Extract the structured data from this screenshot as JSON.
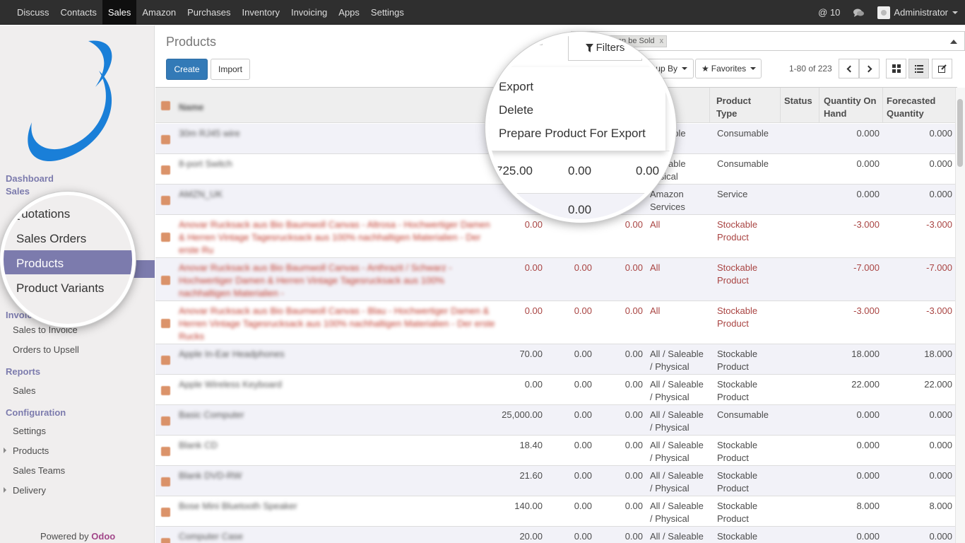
{
  "topbar": {
    "menu": [
      "Discuss",
      "Contacts",
      "Sales",
      "Amazon",
      "Purchases",
      "Inventory",
      "Invoicing",
      "Apps",
      "Settings"
    ],
    "active": "Sales",
    "mentions": "@ 10",
    "user": "Administrator"
  },
  "sidebar": {
    "sections": [
      {
        "title": "Dashboard"
      },
      {
        "title": "Sales",
        "items": [
          "Quotations",
          "Sales Orders",
          "Products",
          "Product Variants"
        ]
      },
      {
        "title": "Invoicing",
        "items": [
          "Sales to Invoice",
          "Orders to Upsell"
        ]
      },
      {
        "title": "Reports",
        "items": [
          "Sales"
        ]
      },
      {
        "title": "Configuration",
        "items": [
          "Settings",
          "Products",
          "Sales Teams",
          "Delivery"
        ]
      }
    ],
    "active_item": "Products",
    "powered_by": "Powered by",
    "powered_brand": "Odoo"
  },
  "main": {
    "title": "Products",
    "create": "Create",
    "import": "Import",
    "search_facet": "Can be Sold",
    "facet_remove": "x",
    "filters": "Filters",
    "group_by": "Group By",
    "favorites": "Favorites",
    "pager": "1-80 of 223"
  },
  "action_menu": {
    "items": [
      "Export",
      "Delete",
      "Prepare Product For Export"
    ]
  },
  "table": {
    "headers": [
      "Name",
      "Internal Category",
      "Product Type",
      "Status",
      "Quantity On Hand",
      "Forecasted Quantity"
    ],
    "header_fragments": {
      "internal_top": "rnal",
      "internal_bottom": "gory"
    },
    "lens_values": {
      "row1_col1": "725.00",
      "row1_col2": "0.00",
      "row1_col3": "0.00",
      "row2_col2": "0.00"
    },
    "rows": [
      {
        "name": "30m RJ45 wire",
        "price": "",
        "c2": "",
        "c3": "",
        "cat": "Saleable",
        "cat2": "ysical",
        "type": "Consumable",
        "type2": "",
        "onhand": "0.000",
        "forecast": "0.000",
        "red": false
      },
      {
        "name": "8-port Switch",
        "price": "",
        "c2": "",
        "c3": "",
        "cat": "Saleable",
        "cat2": "hysical",
        "type": "Consumable",
        "type2": "",
        "onhand": "0.000",
        "forecast": "0.000",
        "red": false
      },
      {
        "name": "AMZN_UK",
        "price": "",
        "c2": "",
        "c3": "",
        "cat": "Amazon",
        "cat2": "Services",
        "type": "Service",
        "type2": "",
        "onhand": "0.000",
        "forecast": "0.000",
        "red": false
      },
      {
        "name": "Anovar Rucksack aus Bio Baumwoll Canvas - Altrosa - Hochwertiger Damen & Herren Vintage Tagesrucksack aus 100% nachhaltigen Materialien - Der erste Ru",
        "price": "0.00",
        "c2": "",
        "c3": "0.00",
        "cat": "All",
        "cat2": "",
        "type": "Stockable",
        "type2": "Product",
        "onhand": "-3.000",
        "forecast": "-3.000",
        "red": true
      },
      {
        "name": "Anovar Rucksack aus Bio Baumwoll Canvas - Anthrazit / Schwarz - Hochwertiger Damen & Herren Vintage Tagesrucksack aus 100% nachhaltigen Materialien -",
        "price": "0.00",
        "c2": "0.00",
        "c3": "0.00",
        "cat": "All",
        "cat2": "",
        "type": "Stockable",
        "type2": "Product",
        "onhand": "-7.000",
        "forecast": "-7.000",
        "red": true
      },
      {
        "name": "Anovar Rucksack aus Bio Baumwoll Canvas - Blau - Hochwertiger Damen & Herren Vintage Tagesrucksack aus 100% nachhaltigen Materialien - Der erste Rucks",
        "price": "0.00",
        "c2": "0.00",
        "c3": "0.00",
        "cat": "All",
        "cat2": "",
        "type": "Stockable",
        "type2": "Product",
        "onhand": "-3.000",
        "forecast": "-3.000",
        "red": true
      },
      {
        "name": "Apple In-Ear Headphones",
        "price": "70.00",
        "c2": "0.00",
        "c3": "0.00",
        "cat": "All / Saleable",
        "cat2": "/ Physical",
        "type": "Stockable",
        "type2": "Product",
        "onhand": "18.000",
        "forecast": "18.000",
        "red": false
      },
      {
        "name": "Apple Wireless Keyboard",
        "price": "0.00",
        "c2": "0.00",
        "c3": "0.00",
        "cat": "All / Saleable",
        "cat2": "/ Physical",
        "type": "Stockable",
        "type2": "Product",
        "onhand": "22.000",
        "forecast": "22.000",
        "red": false
      },
      {
        "name": "Basic Computer",
        "price": "25,000.00",
        "c2": "0.00",
        "c3": "0.00",
        "cat": "All / Saleable",
        "cat2": "/ Physical",
        "type": "Consumable",
        "type2": "",
        "onhand": "0.000",
        "forecast": "0.000",
        "red": false
      },
      {
        "name": "Blank CD",
        "price": "18.40",
        "c2": "0.00",
        "c3": "0.00",
        "cat": "All / Saleable",
        "cat2": "/ Physical",
        "type": "Stockable",
        "type2": "Product",
        "onhand": "0.000",
        "forecast": "0.000",
        "red": false
      },
      {
        "name": "Blank DVD-RW",
        "price": "21.60",
        "c2": "0.00",
        "c3": "0.00",
        "cat": "All / Saleable",
        "cat2": "/ Physical",
        "type": "Stockable",
        "type2": "Product",
        "onhand": "0.000",
        "forecast": "0.000",
        "red": false
      },
      {
        "name": "Bose Mini Bluetooth Speaker",
        "price": "140.00",
        "c2": "0.00",
        "c3": "0.00",
        "cat": "All / Saleable",
        "cat2": "/ Physical",
        "type": "Stockable",
        "type2": "Product",
        "onhand": "8.000",
        "forecast": "8.000",
        "red": false
      },
      {
        "name": "Computer Case",
        "price": "20.00",
        "c2": "0.00",
        "c3": "0.00",
        "cat": "All / Saleable",
        "cat2": "/ Physical",
        "type": "Stockable",
        "type2": "Product",
        "onhand": "0.000",
        "forecast": "0.000",
        "red": false
      }
    ]
  },
  "colors": {
    "accent": "#7c7bad",
    "primary": "#337ab7",
    "topbar": "#2f2f2f",
    "danger": "#a94442",
    "brand": "#a24689"
  }
}
